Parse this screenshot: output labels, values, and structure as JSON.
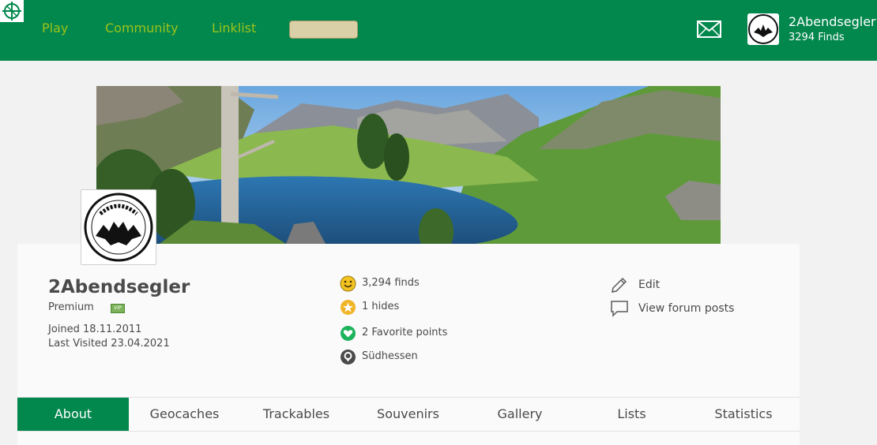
{
  "header": {
    "nav": [
      "Play",
      "Community",
      "Linklist"
    ],
    "user": {
      "name": "2Abendsegler",
      "finds": "3294 Finds"
    },
    "colors": {
      "background": "#02874d",
      "nav_text": "#9dc31b"
    }
  },
  "profile": {
    "avatar_text": "2Abendsegler",
    "username": "2Abendsegler",
    "membership": "Premium",
    "badge": "VIP",
    "joined": "Joined 18.11.2011",
    "last_visited": "Last Visited 23.04.2021"
  },
  "stats": [
    {
      "icon": "smiley-icon",
      "label": "3,294 finds"
    },
    {
      "icon": "star-icon",
      "label": "1 hides"
    },
    {
      "icon": "heart-icon",
      "label": "2 Favorite points"
    },
    {
      "icon": "location-pin-icon",
      "label": "Südhessen"
    }
  ],
  "actions": [
    {
      "icon": "pencil-icon",
      "label": "Edit"
    },
    {
      "icon": "speech-bubble-icon",
      "label": "View forum posts"
    }
  ],
  "tabs": [
    {
      "label": "About",
      "active": true
    },
    {
      "label": "Geocaches"
    },
    {
      "label": "Trackables"
    },
    {
      "label": "Souvenirs"
    },
    {
      "label": "Gallery"
    },
    {
      "label": "Lists"
    },
    {
      "label": "Statistics"
    }
  ]
}
